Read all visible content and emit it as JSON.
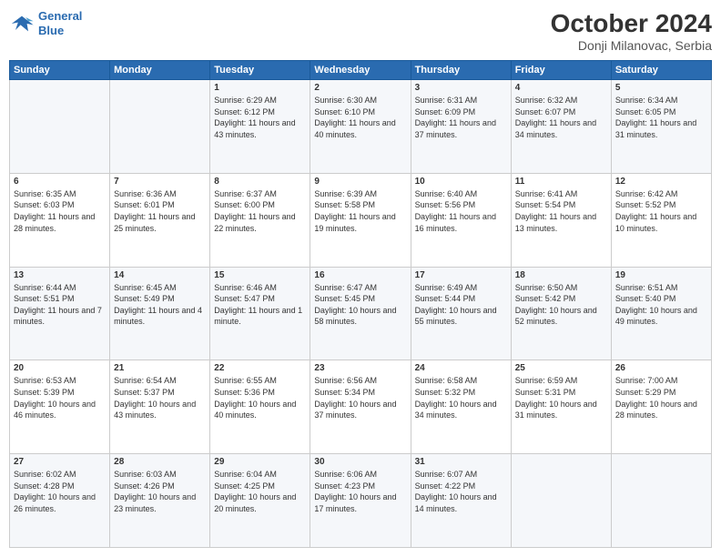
{
  "header": {
    "logo_line1": "General",
    "logo_line2": "Blue",
    "month": "October 2024",
    "location": "Donji Milanovac, Serbia"
  },
  "columns": [
    "Sunday",
    "Monday",
    "Tuesday",
    "Wednesday",
    "Thursday",
    "Friday",
    "Saturday"
  ],
  "weeks": [
    [
      {
        "day": "",
        "info": ""
      },
      {
        "day": "",
        "info": ""
      },
      {
        "day": "1",
        "info": "Sunrise: 6:29 AM\nSunset: 6:12 PM\nDaylight: 11 hours and 43 minutes."
      },
      {
        "day": "2",
        "info": "Sunrise: 6:30 AM\nSunset: 6:10 PM\nDaylight: 11 hours and 40 minutes."
      },
      {
        "day": "3",
        "info": "Sunrise: 6:31 AM\nSunset: 6:09 PM\nDaylight: 11 hours and 37 minutes."
      },
      {
        "day": "4",
        "info": "Sunrise: 6:32 AM\nSunset: 6:07 PM\nDaylight: 11 hours and 34 minutes."
      },
      {
        "day": "5",
        "info": "Sunrise: 6:34 AM\nSunset: 6:05 PM\nDaylight: 11 hours and 31 minutes."
      }
    ],
    [
      {
        "day": "6",
        "info": "Sunrise: 6:35 AM\nSunset: 6:03 PM\nDaylight: 11 hours and 28 minutes."
      },
      {
        "day": "7",
        "info": "Sunrise: 6:36 AM\nSunset: 6:01 PM\nDaylight: 11 hours and 25 minutes."
      },
      {
        "day": "8",
        "info": "Sunrise: 6:37 AM\nSunset: 6:00 PM\nDaylight: 11 hours and 22 minutes."
      },
      {
        "day": "9",
        "info": "Sunrise: 6:39 AM\nSunset: 5:58 PM\nDaylight: 11 hours and 19 minutes."
      },
      {
        "day": "10",
        "info": "Sunrise: 6:40 AM\nSunset: 5:56 PM\nDaylight: 11 hours and 16 minutes."
      },
      {
        "day": "11",
        "info": "Sunrise: 6:41 AM\nSunset: 5:54 PM\nDaylight: 11 hours and 13 minutes."
      },
      {
        "day": "12",
        "info": "Sunrise: 6:42 AM\nSunset: 5:52 PM\nDaylight: 11 hours and 10 minutes."
      }
    ],
    [
      {
        "day": "13",
        "info": "Sunrise: 6:44 AM\nSunset: 5:51 PM\nDaylight: 11 hours and 7 minutes."
      },
      {
        "day": "14",
        "info": "Sunrise: 6:45 AM\nSunset: 5:49 PM\nDaylight: 11 hours and 4 minutes."
      },
      {
        "day": "15",
        "info": "Sunrise: 6:46 AM\nSunset: 5:47 PM\nDaylight: 11 hours and 1 minute."
      },
      {
        "day": "16",
        "info": "Sunrise: 6:47 AM\nSunset: 5:45 PM\nDaylight: 10 hours and 58 minutes."
      },
      {
        "day": "17",
        "info": "Sunrise: 6:49 AM\nSunset: 5:44 PM\nDaylight: 10 hours and 55 minutes."
      },
      {
        "day": "18",
        "info": "Sunrise: 6:50 AM\nSunset: 5:42 PM\nDaylight: 10 hours and 52 minutes."
      },
      {
        "day": "19",
        "info": "Sunrise: 6:51 AM\nSunset: 5:40 PM\nDaylight: 10 hours and 49 minutes."
      }
    ],
    [
      {
        "day": "20",
        "info": "Sunrise: 6:53 AM\nSunset: 5:39 PM\nDaylight: 10 hours and 46 minutes."
      },
      {
        "day": "21",
        "info": "Sunrise: 6:54 AM\nSunset: 5:37 PM\nDaylight: 10 hours and 43 minutes."
      },
      {
        "day": "22",
        "info": "Sunrise: 6:55 AM\nSunset: 5:36 PM\nDaylight: 10 hours and 40 minutes."
      },
      {
        "day": "23",
        "info": "Sunrise: 6:56 AM\nSunset: 5:34 PM\nDaylight: 10 hours and 37 minutes."
      },
      {
        "day": "24",
        "info": "Sunrise: 6:58 AM\nSunset: 5:32 PM\nDaylight: 10 hours and 34 minutes."
      },
      {
        "day": "25",
        "info": "Sunrise: 6:59 AM\nSunset: 5:31 PM\nDaylight: 10 hours and 31 minutes."
      },
      {
        "day": "26",
        "info": "Sunrise: 7:00 AM\nSunset: 5:29 PM\nDaylight: 10 hours and 28 minutes."
      }
    ],
    [
      {
        "day": "27",
        "info": "Sunrise: 6:02 AM\nSunset: 4:28 PM\nDaylight: 10 hours and 26 minutes."
      },
      {
        "day": "28",
        "info": "Sunrise: 6:03 AM\nSunset: 4:26 PM\nDaylight: 10 hours and 23 minutes."
      },
      {
        "day": "29",
        "info": "Sunrise: 6:04 AM\nSunset: 4:25 PM\nDaylight: 10 hours and 20 minutes."
      },
      {
        "day": "30",
        "info": "Sunrise: 6:06 AM\nSunset: 4:23 PM\nDaylight: 10 hours and 17 minutes."
      },
      {
        "day": "31",
        "info": "Sunrise: 6:07 AM\nSunset: 4:22 PM\nDaylight: 10 hours and 14 minutes."
      },
      {
        "day": "",
        "info": ""
      },
      {
        "day": "",
        "info": ""
      }
    ]
  ]
}
